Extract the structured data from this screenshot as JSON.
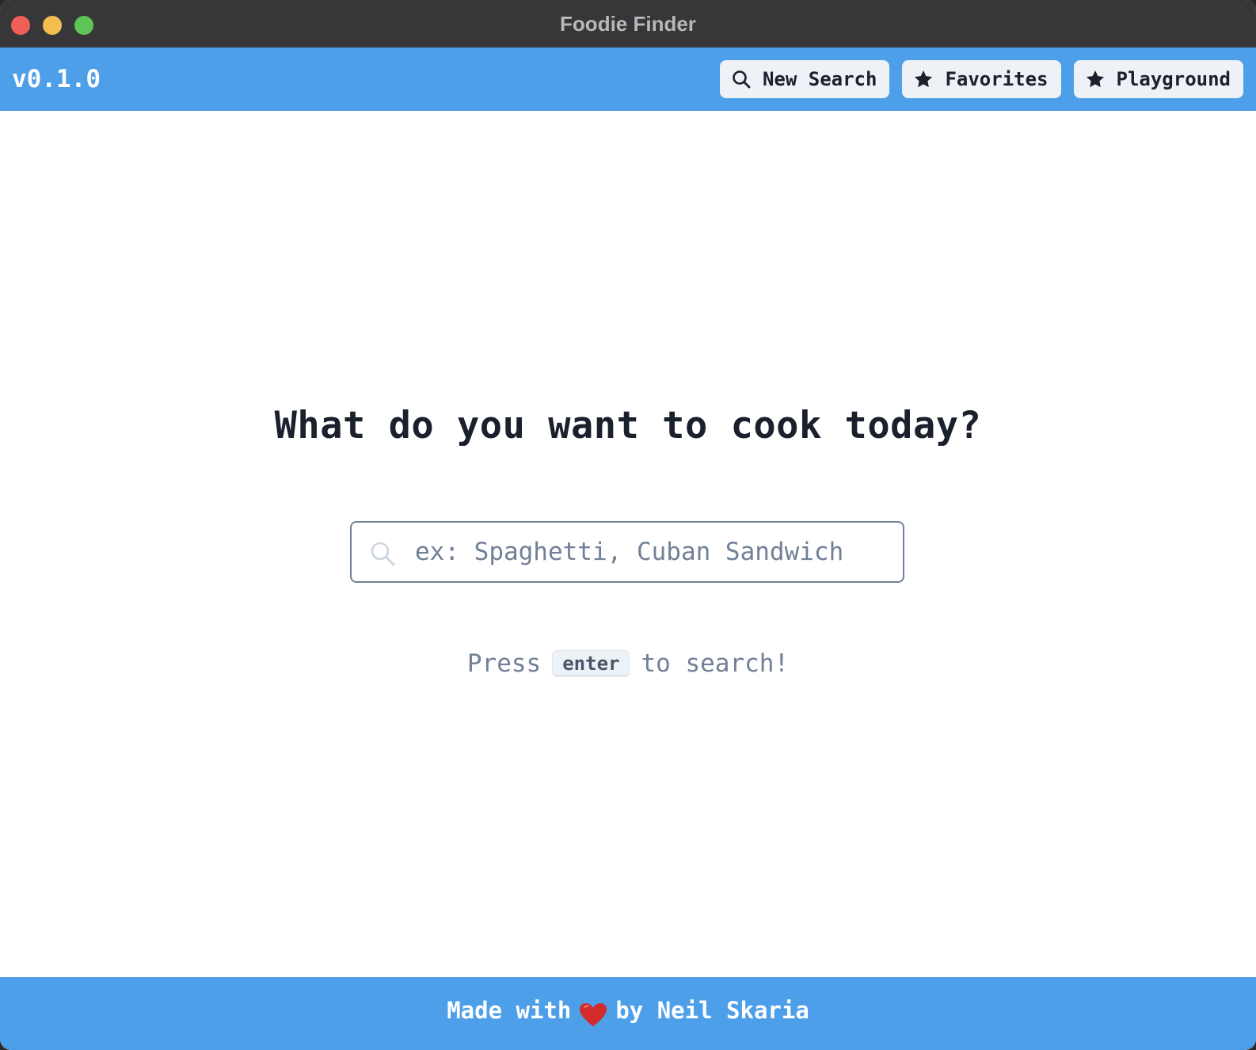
{
  "window": {
    "title": "Foodie Finder"
  },
  "navbar": {
    "version": "v0.1.0",
    "buttons": [
      {
        "label": "New Search",
        "icon": "search-icon"
      },
      {
        "label": "Favorites",
        "icon": "star-icon"
      },
      {
        "label": "Playground",
        "icon": "star-icon"
      }
    ]
  },
  "main": {
    "heading": "What do you want to cook today?",
    "search": {
      "placeholder": "ex: Spaghetti, Cuban Sandwich",
      "value": ""
    },
    "hint": {
      "before": "Press",
      "key": "enter",
      "after": "to search!"
    }
  },
  "footer": {
    "before": "Made with",
    "icon": "heart-icon",
    "after": "by Neil Skaria"
  },
  "colors": {
    "accent": "#4e9fe9",
    "titlebar": "#37373a",
    "heart": "#d22b2b"
  }
}
